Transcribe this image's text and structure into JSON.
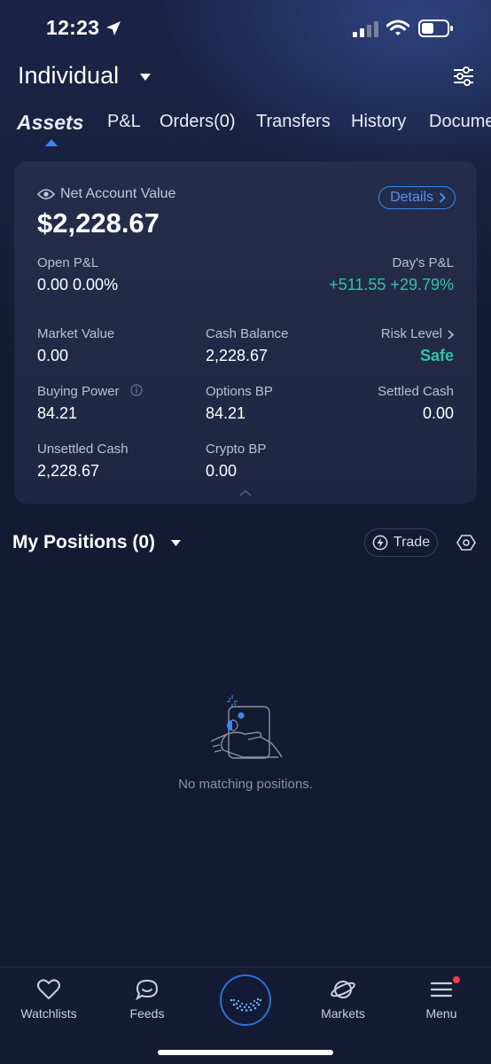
{
  "status_bar": {
    "time": "12:23"
  },
  "header": {
    "account_name": "Individual"
  },
  "tabs": [
    {
      "label": "Assets",
      "active": true
    },
    {
      "label": "P&L"
    },
    {
      "label": "Orders(0)"
    },
    {
      "label": "Transfers"
    },
    {
      "label": "History"
    },
    {
      "label": "Docume"
    }
  ],
  "summary": {
    "net_label": "Net Account Value",
    "net_value": "$2,228.67",
    "details_label": "Details",
    "open_pl_label": "Open P&L",
    "open_pl_value": "0.00 0.00%",
    "day_pl_label": "Day's P&L",
    "day_pl_value": "+511.55 +29.79%",
    "market_value_label": "Market Value",
    "market_value": "0.00",
    "cash_balance_label": "Cash Balance",
    "cash_balance": "2,228.67",
    "risk_level_label": "Risk Level",
    "risk_level": "Safe",
    "buying_power_label": "Buying Power",
    "buying_power": "84.21",
    "options_bp_label": "Options BP",
    "options_bp": "84.21",
    "settled_cash_label": "Settled Cash",
    "settled_cash": "0.00",
    "unsettled_cash_label": "Unsettled Cash",
    "unsettled_cash": "2,228.67",
    "crypto_bp_label": "Crypto BP",
    "crypto_bp": "0.00"
  },
  "positions": {
    "title": "My Positions (0)",
    "trade_label": "Trade",
    "empty_text": "No matching positions."
  },
  "bottom_nav": [
    {
      "label": "Watchlists",
      "icon": "heart-icon"
    },
    {
      "label": "Feeds",
      "icon": "chat-icon"
    },
    {
      "label": "",
      "icon": "home-orb-icon"
    },
    {
      "label": "Markets",
      "icon": "planet-icon"
    },
    {
      "label": "Menu",
      "icon": "menu-icon",
      "badge": true
    }
  ],
  "colors": {
    "background": "#141a31",
    "card": "#232b49",
    "accent": "#3d86f0",
    "positive": "#2ec5a3",
    "badge": "#ef3b4a"
  }
}
